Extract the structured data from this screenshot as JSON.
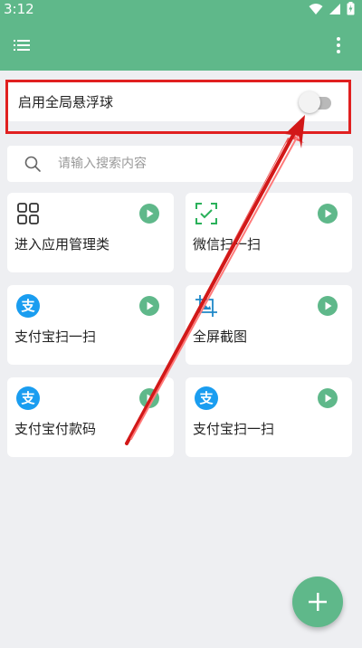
{
  "status_bar": {
    "time": "3:12",
    "icons": [
      "wifi-icon",
      "signal-icon",
      "battery-charging-icon"
    ]
  },
  "app_bar": {
    "background": "#5fb88a",
    "left_icon": "menu-list-icon",
    "right_icon": "more-vertical-icon"
  },
  "floating_ball": {
    "label": "启用全局悬浮球",
    "enabled": false
  },
  "search": {
    "placeholder": "请输入搜索内容",
    "value": ""
  },
  "tiles": [
    {
      "label": "进入应用管理类",
      "icon": "grid-apps-icon"
    },
    {
      "label": "微信扫一扫",
      "icon": "scan-frame-icon"
    },
    {
      "label": "支付宝扫一扫",
      "icon": "alipay-icon",
      "icon_text": "支"
    },
    {
      "label": "全屏截图",
      "icon": "screenshot-icon"
    },
    {
      "label": "支付宝付款码",
      "icon": "alipay-icon",
      "icon_text": "支"
    },
    {
      "label": "支付宝扫一扫",
      "icon": "alipay-icon",
      "icon_text": "支"
    }
  ],
  "colors": {
    "accent": "#5fb88a",
    "alipay": "#1a9df0",
    "annotation": "#e02020"
  },
  "fab": {
    "icon": "plus-icon"
  }
}
